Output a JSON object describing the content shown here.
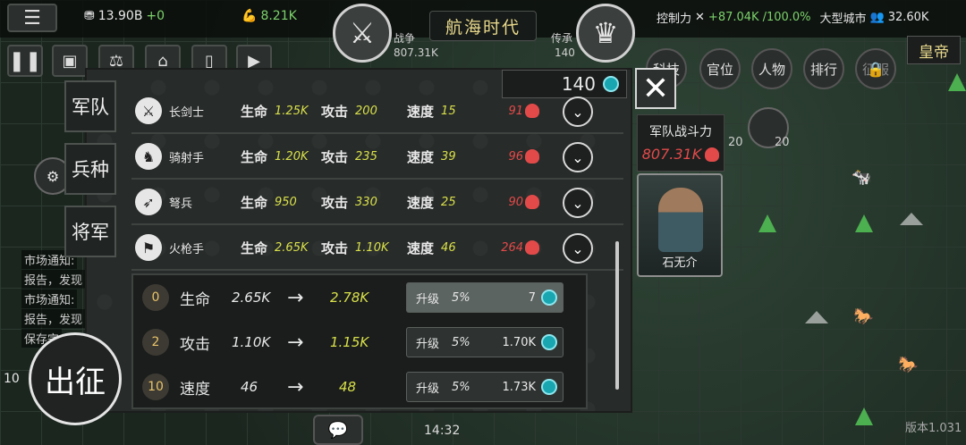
{
  "topbar": {
    "silver": "13.90B",
    "silver_delta": "+0",
    "food": "8.21K",
    "era_title": "航海时代",
    "war_label": "战争",
    "war_value": "807.31K",
    "legend_label": "传承",
    "legend_value": "140",
    "control_label": "控制力",
    "control_value": "+87.04K",
    "control_pct": "/100.0%",
    "city_label": "大型城市",
    "population": "32.60K",
    "rank": "皇帝"
  },
  "round_tabs": [
    "科技",
    "官位",
    "人物",
    "排行",
    "征服"
  ],
  "tiny_counts": [
    "20",
    "20"
  ],
  "panel": {
    "currency_value": "140",
    "units": [
      {
        "name": "长剑士",
        "hp_label": "生命",
        "hp": "1.25K",
        "atk_label": "攻击",
        "atk": "200",
        "spd_label": "速度",
        "spd": "15",
        "power": "91",
        "icon": "sword-icon"
      },
      {
        "name": "骑射手",
        "hp_label": "生命",
        "hp": "1.20K",
        "atk_label": "攻击",
        "atk": "235",
        "spd_label": "速度",
        "spd": "39",
        "power": "96",
        "icon": "horse-archer-icon"
      },
      {
        "name": "弩兵",
        "hp_label": "生命",
        "hp": "950",
        "atk_label": "攻击",
        "atk": "330",
        "spd_label": "速度",
        "spd": "25",
        "power": "90",
        "icon": "crossbow-icon"
      },
      {
        "name": "火枪手",
        "hp_label": "生命",
        "hp": "2.65K",
        "atk_label": "攻击",
        "atk": "1.10K",
        "spd_label": "速度",
        "spd": "46",
        "power": "264",
        "icon": "musket-icon"
      }
    ],
    "upgrades": [
      {
        "level": "0",
        "label": "生命",
        "from": "2.65K",
        "to": "2.78K",
        "btn_label": "升级",
        "pct": "5%",
        "cost": "7"
      },
      {
        "level": "2",
        "label": "攻击",
        "from": "1.10K",
        "to": "1.15K",
        "btn_label": "升级",
        "pct": "5%",
        "cost": "1.70K"
      },
      {
        "level": "10",
        "label": "速度",
        "from": "46",
        "to": "48",
        "btn_label": "升级",
        "pct": "5%",
        "cost": "1.73K"
      }
    ]
  },
  "side_tabs": [
    "军队",
    "兵种",
    "将军"
  ],
  "army_power": {
    "label": "军队战斗力",
    "value": "807.31K"
  },
  "general": {
    "name": "石无介"
  },
  "chat": [
    "市场通知:",
    "报告，发现",
    "市场通知:",
    "报告，发现",
    "保存完"
  ],
  "march_label": "出征",
  "left_count": "10",
  "clock": "14:32",
  "version": "版本1.031"
}
